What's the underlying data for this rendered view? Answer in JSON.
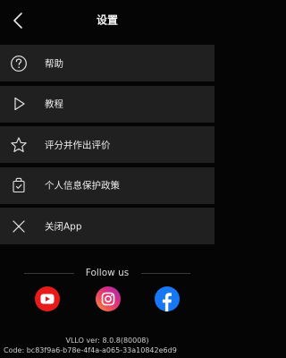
{
  "header": {
    "title": "设置",
    "back_icon": "chevron-left-icon"
  },
  "menu": {
    "items": [
      {
        "label": "帮助",
        "icon": "help-circle-icon"
      },
      {
        "label": "教程",
        "icon": "play-outline-icon"
      },
      {
        "label": "评分并作出评价",
        "icon": "star-outline-icon"
      },
      {
        "label": "个人信息保护政策",
        "icon": "privacy-bag-icon"
      },
      {
        "label": "关闭App",
        "icon": "close-icon"
      }
    ]
  },
  "follow": {
    "label": "Follow us",
    "links": [
      {
        "name": "YouTube",
        "icon": "youtube-icon",
        "color": "#e81b1b"
      },
      {
        "name": "Instagram",
        "icon": "instagram-icon",
        "color": "#dd2a7b"
      },
      {
        "name": "Facebook",
        "icon": "facebook-icon",
        "color": "#1877f2"
      }
    ]
  },
  "footer": {
    "version": "VLLO ver: 8.0.8(80008)",
    "code": "Code: bc83f9a6-b78e-4f4a-a065-33a10842e6d9"
  },
  "colors": {
    "background": "#050505",
    "row_background": "#202020",
    "text": "#efefef"
  }
}
